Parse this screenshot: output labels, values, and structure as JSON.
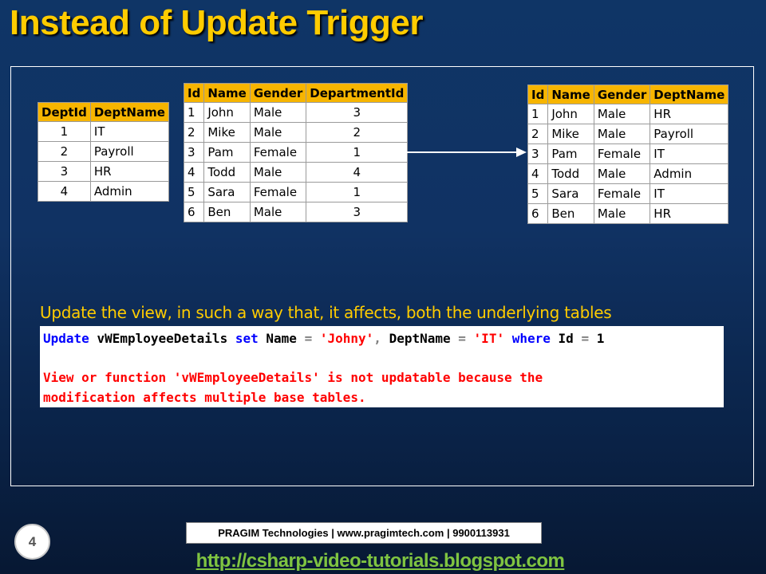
{
  "slide": {
    "title": "Instead of Update Trigger",
    "caption": "Update the view, in such a way that, it affects, both the underlying tables"
  },
  "dept_table": {
    "headers": [
      "DeptId",
      "DeptName"
    ],
    "rows": [
      [
        "1",
        "IT"
      ],
      [
        "2",
        "Payroll"
      ],
      [
        "3",
        "HR"
      ],
      [
        "4",
        "Admin"
      ]
    ]
  },
  "employee_table": {
    "headers": [
      "Id",
      "Name",
      "Gender",
      "DepartmentId"
    ],
    "rows": [
      [
        "1",
        "John",
        "Male",
        "3"
      ],
      [
        "2",
        "Mike",
        "Male",
        "2"
      ],
      [
        "3",
        "Pam",
        "Female",
        "1"
      ],
      [
        "4",
        "Todd",
        "Male",
        "4"
      ],
      [
        "5",
        "Sara",
        "Female",
        "1"
      ],
      [
        "6",
        "Ben",
        "Male",
        "3"
      ]
    ]
  },
  "view_table": {
    "headers": [
      "Id",
      "Name",
      "Gender",
      "DeptName"
    ],
    "rows": [
      [
        "1",
        "John",
        "Male",
        "HR"
      ],
      [
        "2",
        "Mike",
        "Male",
        "Payroll"
      ],
      [
        "3",
        "Pam",
        "Female",
        "IT"
      ],
      [
        "4",
        "Todd",
        "Male",
        "Admin"
      ],
      [
        "5",
        "Sara",
        "Female",
        "IT"
      ],
      [
        "6",
        "Ben",
        "Male",
        "HR"
      ]
    ]
  },
  "code": {
    "kw_update": "Update",
    "view_name": "vWEmployeeDetails",
    "kw_set": "set",
    "col_name": "Name",
    "eq1": "=",
    "val_name": "'Johny'",
    "comma": ",",
    "col_dept": "DeptName",
    "eq2": "=",
    "val_dept": "'IT'",
    "kw_where": "where",
    "col_id": "Id",
    "eq3": "=",
    "val_id": "1",
    "error_line1": "View or function 'vWEmployeeDetails' is not updatable because the",
    "error_line2": "modification affects multiple base tables."
  },
  "footer": {
    "page_number": "4",
    "company": "PRAGIM Technologies | www.pragimtech.com | 9900113931",
    "link": "http://csharp-video-tutorials.blogspot.com"
  },
  "colors": {
    "title": "#ffcc00",
    "header_fill": "#f7b500",
    "keyword": "#0000ff",
    "string": "#ff0000",
    "link": "#7fc441"
  }
}
